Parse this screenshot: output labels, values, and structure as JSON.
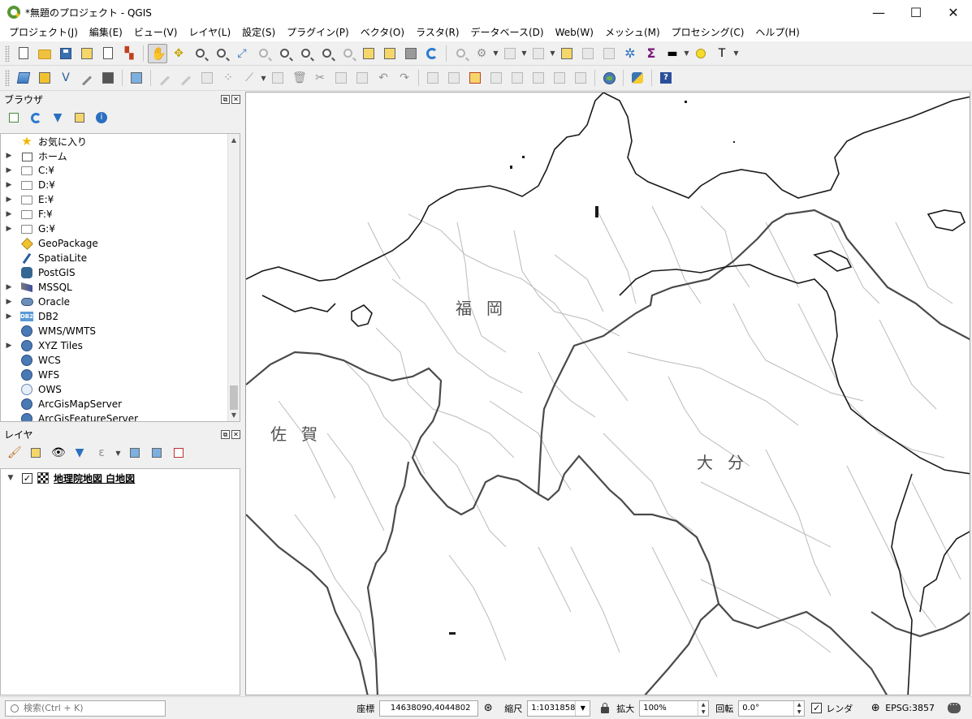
{
  "window": {
    "title": "*無題のプロジェクト - QGIS",
    "minimize": "—",
    "maximize": "☐",
    "close": "✕"
  },
  "menu": [
    "プロジェクト(J)",
    "編集(E)",
    "ビュー(V)",
    "レイヤ(L)",
    "設定(S)",
    "プラグイン(P)",
    "ベクタ(O)",
    "ラスタ(R)",
    "データベース(D)",
    "Web(W)",
    "メッシュ(M)",
    "プロセシング(C)",
    "ヘルプ(H)"
  ],
  "browser": {
    "title": "ブラウザ",
    "float_button": "⧉",
    "close_button": "✕",
    "items": [
      {
        "label": "お気に入り",
        "icon": "star-icon",
        "expandable": false
      },
      {
        "label": "ホーム",
        "icon": "home-icon",
        "expandable": true
      },
      {
        "label": "C:¥",
        "icon": "folder-icon",
        "expandable": true
      },
      {
        "label": "D:¥",
        "icon": "folder-icon",
        "expandable": true
      },
      {
        "label": "E:¥",
        "icon": "folder-icon",
        "expandable": true
      },
      {
        "label": "F:¥",
        "icon": "folder-icon",
        "expandable": true
      },
      {
        "label": "G:¥",
        "icon": "folder-icon",
        "expandable": true
      },
      {
        "label": "GeoPackage",
        "icon": "geopackage-icon",
        "expandable": false
      },
      {
        "label": "SpatiaLite",
        "icon": "spatialite-icon",
        "expandable": false
      },
      {
        "label": "PostGIS",
        "icon": "postgis-icon",
        "expandable": false
      },
      {
        "label": "MSSQL",
        "icon": "mssql-icon",
        "expandable": true
      },
      {
        "label": "Oracle",
        "icon": "oracle-icon",
        "expandable": true
      },
      {
        "label": "DB2",
        "icon": "db2-icon",
        "expandable": true
      },
      {
        "label": "WMS/WMTS",
        "icon": "wms-globe-icon",
        "expandable": false
      },
      {
        "label": "XYZ Tiles",
        "icon": "xyz-globe-icon",
        "expandable": true
      },
      {
        "label": "WCS",
        "icon": "wcs-globe-icon",
        "expandable": false
      },
      {
        "label": "WFS",
        "icon": "wfs-globe-icon",
        "expandable": false
      },
      {
        "label": "OWS",
        "icon": "ows-globe-icon",
        "expandable": false
      },
      {
        "label": "ArcGisMapServer",
        "icon": "arcgis-map-icon",
        "expandable": false
      },
      {
        "label": "ArcGisFeatureServer",
        "icon": "arcgis-feature-icon",
        "expandable": false
      }
    ]
  },
  "layers": {
    "title": "レイヤ",
    "float_button": "⧉",
    "close_button": "✕",
    "items": [
      {
        "name": "地理院地図 白地図",
        "checked": true
      }
    ]
  },
  "map": {
    "labels": [
      {
        "text": "福岡"
      },
      {
        "text": "佐賀"
      },
      {
        "text": "大分"
      }
    ]
  },
  "status": {
    "search_placeholder": "検索(Ctrl + K)",
    "coord_label": "座標",
    "coord_value": "14638090,4044802",
    "scale_label": "縮尺",
    "scale_value": "1:1031858",
    "magnifier_label": "拡大",
    "magnifier_value": "100%",
    "rotation_label": "回転",
    "rotation_value": "0.0°",
    "render_label": "レンダ",
    "render_checked": true,
    "crs": "EPSG:3857"
  }
}
